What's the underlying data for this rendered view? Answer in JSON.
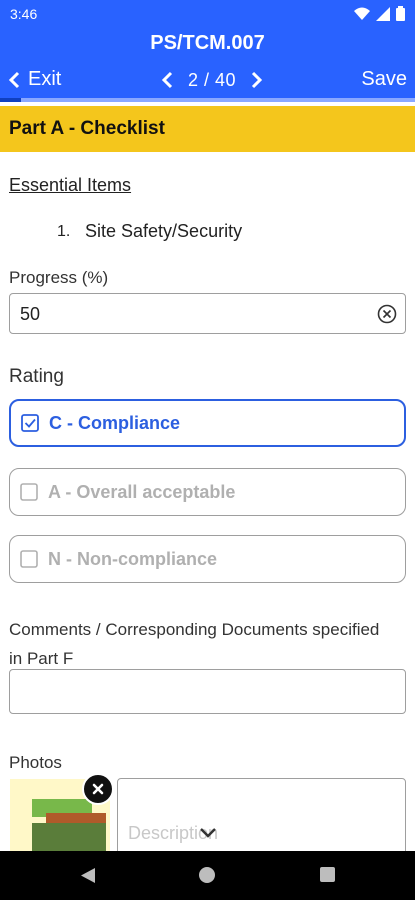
{
  "status_bar": {
    "time": "3:46",
    "icons": [
      "wifi-icon",
      "signal-icon",
      "battery-icon"
    ]
  },
  "header": {
    "title": "PS/TCM.007",
    "exit_label": "Exit",
    "pager_text": "2 / 40",
    "save_label": "Save",
    "progress_fraction": 0.05
  },
  "section": {
    "title": "Part A - Checklist"
  },
  "essential": {
    "heading": "Essential Items",
    "items": [
      {
        "number": "1.",
        "label": "Site Safety/Security"
      }
    ]
  },
  "progress": {
    "label": "Progress (%)",
    "value": "50"
  },
  "rating": {
    "label": "Rating",
    "options": [
      {
        "label": "C - Compliance",
        "checked": true
      },
      {
        "label": "A - Overall acceptable",
        "checked": false
      },
      {
        "label": "N - Non-compliance",
        "checked": false
      }
    ]
  },
  "comments": {
    "label": "Comments / Corresponding Documents specified in Part F",
    "value": ""
  },
  "photos": {
    "label": "Photos",
    "description_placeholder": "Description"
  },
  "colors": {
    "primary": "#2962ff",
    "banner": "#f4c61c",
    "selected": "#2c5fe0"
  }
}
